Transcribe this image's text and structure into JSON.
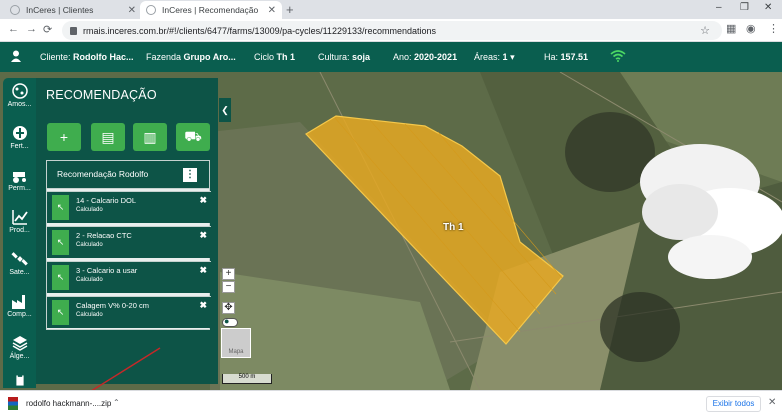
{
  "browser": {
    "tabs": [
      {
        "title": "InCeres | Clientes",
        "close": "✕"
      },
      {
        "title": "InCeres | Recomendação",
        "close": "✕"
      }
    ],
    "new_tab": "+",
    "window_controls": {
      "minimize": "–",
      "maximize": "❐",
      "close": "✕"
    },
    "nav": {
      "back": "←",
      "forward": "→",
      "reload": "⟳"
    },
    "url": "rmais.inceres.com.br/#!/clients/6477/farms/13009/pa-cycles/11229133/recommendations",
    "star": "☆",
    "toolbar_icons": {
      "translate": "▦",
      "account": "◉",
      "menu": "⋮"
    }
  },
  "appbar": {
    "cliente_label": "Cliente:",
    "cliente_value": "Rodolfo Hac...",
    "fazenda_label": "Fazenda",
    "fazenda_value": "Grupo Aro...",
    "ciclo_label": "Ciclo",
    "ciclo_value": "Th 1",
    "cultura_label": "Cultura:",
    "cultura_value": "soja",
    "ano_label": "Ano:",
    "ano_value": "2020-2021",
    "areas_label": "Áreas:",
    "areas_value": "1",
    "ha_label": "Ha:",
    "ha_value": "157.51"
  },
  "leftnav": [
    {
      "label": "Amos...",
      "icon": "sample-icon"
    },
    {
      "label": "Fert...",
      "icon": "fertility-icon"
    },
    {
      "label": "Perm...",
      "icon": "tractor-icon"
    },
    {
      "label": "Prod...",
      "icon": "chart-icon"
    },
    {
      "label": "Sate...",
      "icon": "satellite-icon"
    },
    {
      "label": "Comp...",
      "icon": "factory-icon"
    },
    {
      "label": "Álge...",
      "icon": "layers-icon"
    },
    {
      "label": "",
      "icon": "clipboard-icon"
    }
  ],
  "panel": {
    "title": "RECOMENDAÇÃO",
    "actions": [
      {
        "icon": "add-icon",
        "glyph": "+"
      },
      {
        "icon": "document-icon",
        "glyph": "▤"
      },
      {
        "icon": "books-icon",
        "glyph": "▥"
      },
      {
        "icon": "tractor-icon",
        "glyph": "⛟"
      }
    ],
    "card_title": "Recomendação Rodolfo",
    "card_menu": "⋮",
    "items": [
      {
        "name": "14 - Calcario DOL",
        "status": "Calculado"
      },
      {
        "name": "2 - Relacao CTC",
        "status": "Calculado"
      },
      {
        "name": "3 - Calcario a usar",
        "status": "Calculado"
      },
      {
        "name": "Calagem V% 0-20 cm",
        "status": "Calculado"
      }
    ],
    "delete_glyph": "✖",
    "grip_glyph": "↖"
  },
  "map": {
    "field_label": "Th 1",
    "collapse_glyph": "❮",
    "zoom_in": "+",
    "zoom_out": "−",
    "pan": "✥",
    "toggle": "●",
    "basemap_label": "Mapa",
    "scale_label": "500 m",
    "field_color": "#e5a823"
  },
  "download": {
    "filename": "rodolfo hackmann-....zip",
    "chevron": "⌃",
    "show_all": "Exibir todos",
    "close": "✕"
  }
}
